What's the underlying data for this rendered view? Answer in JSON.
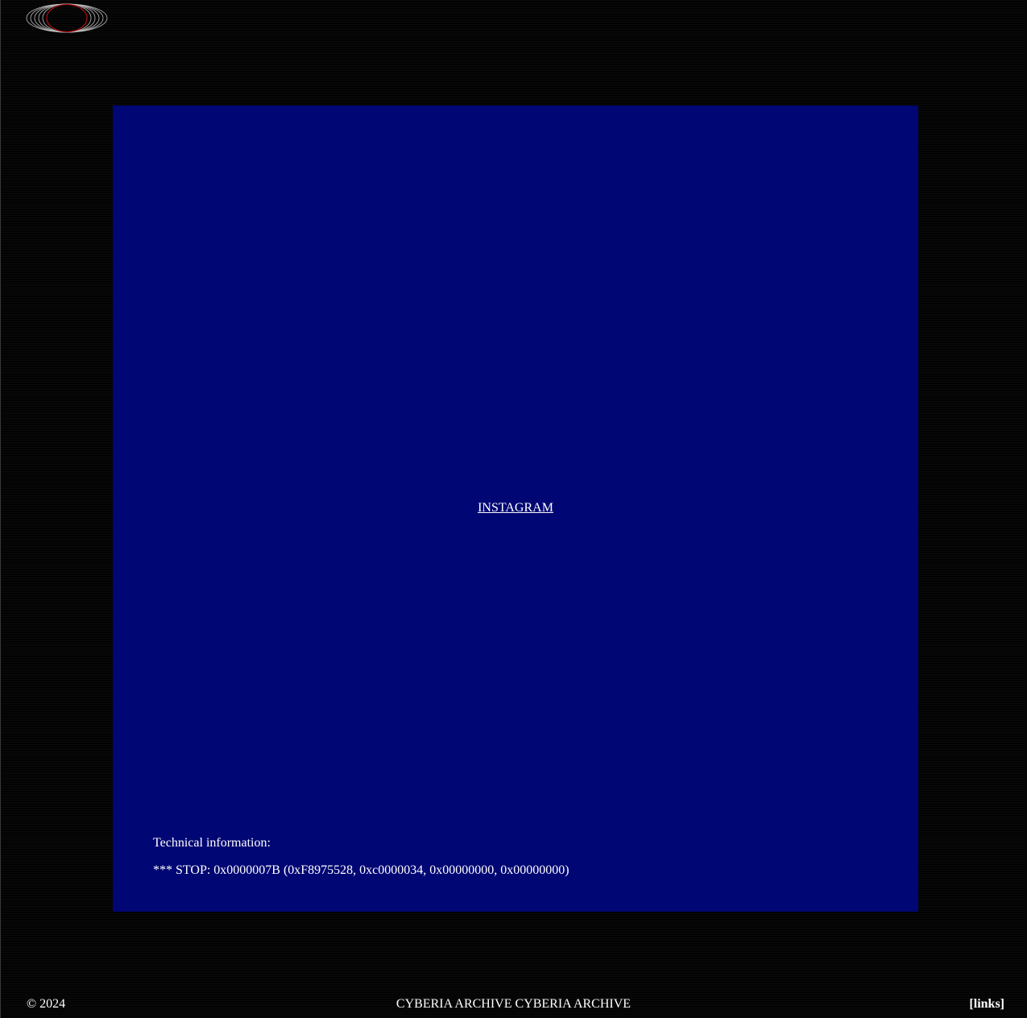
{
  "header": {
    "logo_icon": "orbit-rings-logo-icon",
    "logo_accent_color": "#b01010"
  },
  "panel": {
    "background_color": "#000673",
    "link_label": "INSTAGRAM",
    "technical_label": "Technical information:",
    "stop_code": "*** STOP: 0x0000007B (0xF8975528, 0xc0000034, 0x00000000, 0x00000000)"
  },
  "footer": {
    "copyright": "© 2024",
    "marquee_text": "CYBERIA ARCHIVE CYBERIA ARCHIVE",
    "links_label": "[links]"
  }
}
